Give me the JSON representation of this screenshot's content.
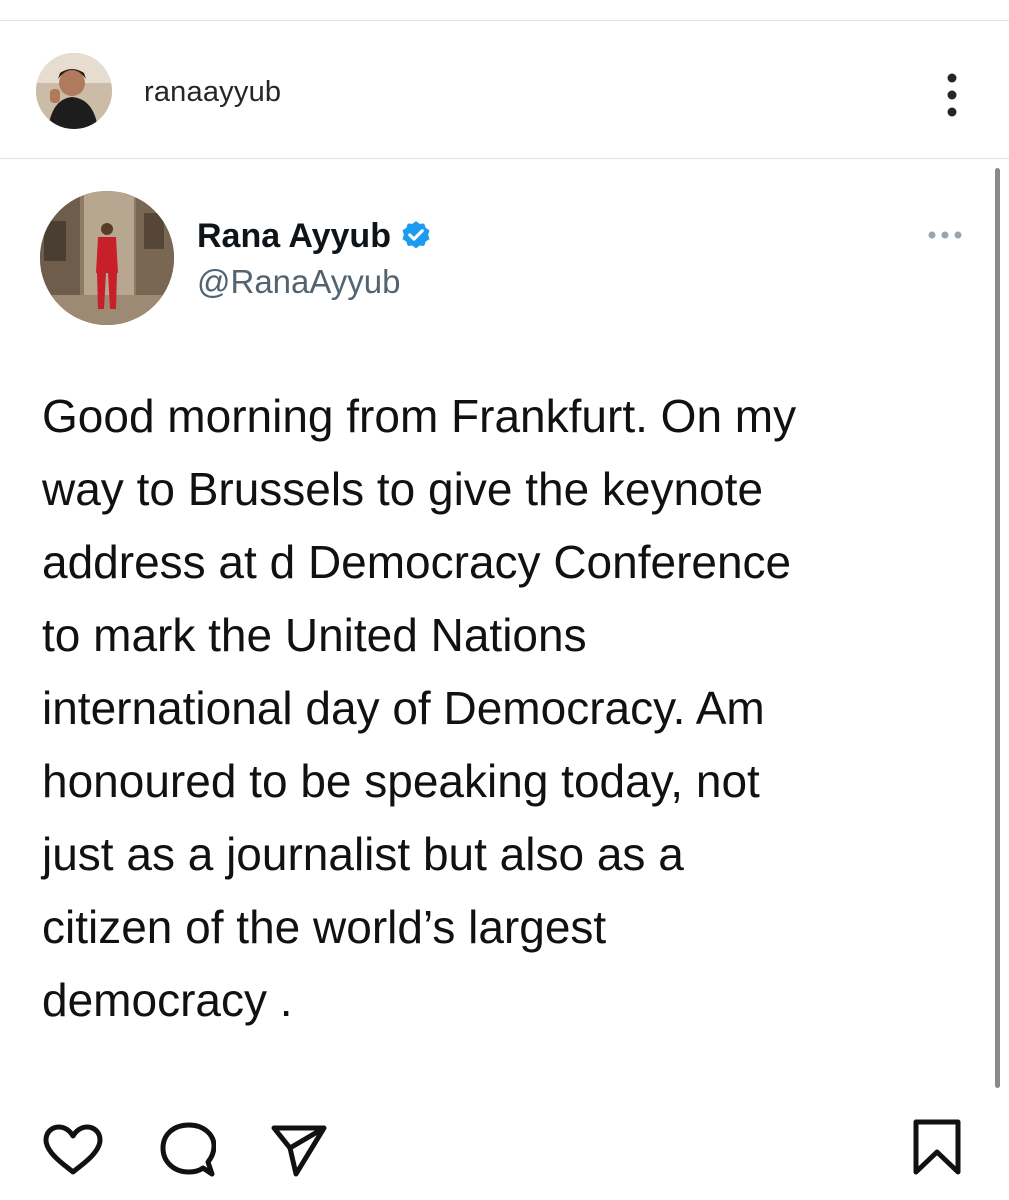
{
  "post_header": {
    "username": "ranaayyub",
    "more_icon": "vertical-ellipsis-icon"
  },
  "tweet": {
    "display_name": "Rana Ayyub",
    "verified": true,
    "verified_color": "#1d9bf0",
    "handle": "@RanaAyyub",
    "more_icon": "horizontal-ellipsis-icon",
    "text": "Good morning from Frankfurt. On my\nway to Brussels to give the keynote\naddress at d Democracy Conference\nto mark the United Nations\ninternational day of Democracy. Am\nhonoured to be speaking today, not\njust as a journalist but also as a\ncitizen of the world’s largest\ndemocracy ."
  },
  "actions": {
    "like_icon": "heart-icon",
    "comment_icon": "comment-bubble-icon",
    "share_icon": "paper-plane-icon",
    "save_icon": "bookmark-icon"
  },
  "colors": {
    "text": "#111111",
    "handle": "#536471",
    "divider": "#e2e2e2"
  }
}
